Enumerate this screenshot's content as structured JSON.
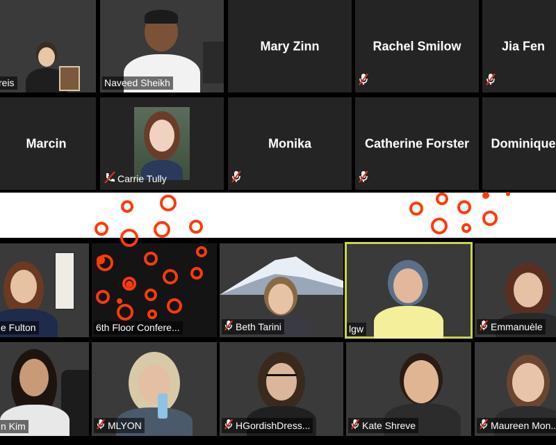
{
  "top_grid": {
    "row1": [
      {
        "name": "reis",
        "kind": "video",
        "muted": false
      },
      {
        "name": "Naveed Sheikh",
        "kind": "video",
        "muted": false
      },
      {
        "name": "Mary Zinn",
        "kind": "name",
        "muted": false
      },
      {
        "name": "Rachel Smilow",
        "kind": "name",
        "muted": true
      },
      {
        "name": "Jia Fen",
        "kind": "name",
        "muted": true
      }
    ],
    "row2": [
      {
        "name": "Marcin",
        "kind": "name",
        "muted": false
      },
      {
        "name": "Carrie Tully",
        "kind": "photo",
        "muted": true
      },
      {
        "name": "Monika",
        "kind": "name",
        "muted": true
      },
      {
        "name": "Catherine Forster",
        "kind": "name",
        "muted": true
      },
      {
        "name": "Dominique",
        "kind": "name",
        "muted": false
      }
    ]
  },
  "bottom_grid": {
    "row1": [
      {
        "name": "e Fulton",
        "muted": false
      },
      {
        "name": "6th Floor Confere...",
        "muted": false
      },
      {
        "name": "Beth Tarini",
        "muted": true
      },
      {
        "name": "lgw",
        "muted": false,
        "active": true
      },
      {
        "name": "Emmanuèle",
        "muted": true
      }
    ],
    "row2": [
      {
        "name": "n Kim",
        "muted": false
      },
      {
        "name": "MLYON",
        "muted": true
      },
      {
        "name": "HGordishDress...",
        "muted": true
      },
      {
        "name": "Kate Shreve",
        "muted": true
      },
      {
        "name": "Maureen Mon...",
        "muted": true
      }
    ]
  },
  "colors": {
    "active_speaker_border": "#c9d64a",
    "mute_icon": "#e0301e",
    "tile_bg": "#242424",
    "dots": "#ff3a0a"
  },
  "icons": {
    "mute": "microphone-muted-icon"
  }
}
